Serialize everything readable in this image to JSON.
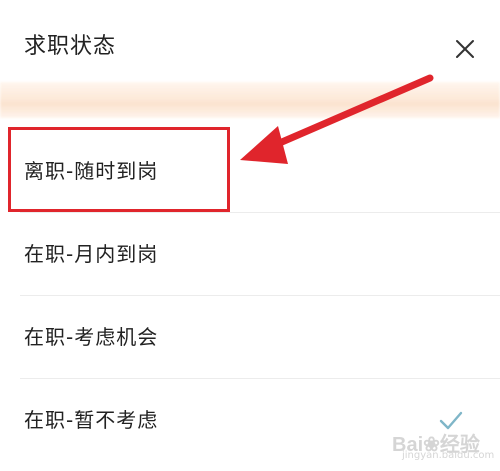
{
  "sheet": {
    "title": "求职状态",
    "close_icon": "close-icon"
  },
  "options": [
    {
      "label": "离职-随时到岗",
      "highlighted": true,
      "selected": false
    },
    {
      "label": "在职-月内到岗",
      "highlighted": false,
      "selected": false
    },
    {
      "label": "在职-考虑机会",
      "highlighted": false,
      "selected": false
    },
    {
      "label": "在职-暂不考虑",
      "highlighted": false,
      "selected": true
    }
  ],
  "annotation": {
    "box_color": "#e0252c",
    "arrow_color": "#e0252c"
  },
  "check_icon": "check-icon",
  "check_color": "#7fb6c8",
  "watermark": {
    "text": "Bai",
    "text2": "经验",
    "sub": "jingyan.baidu.com"
  }
}
